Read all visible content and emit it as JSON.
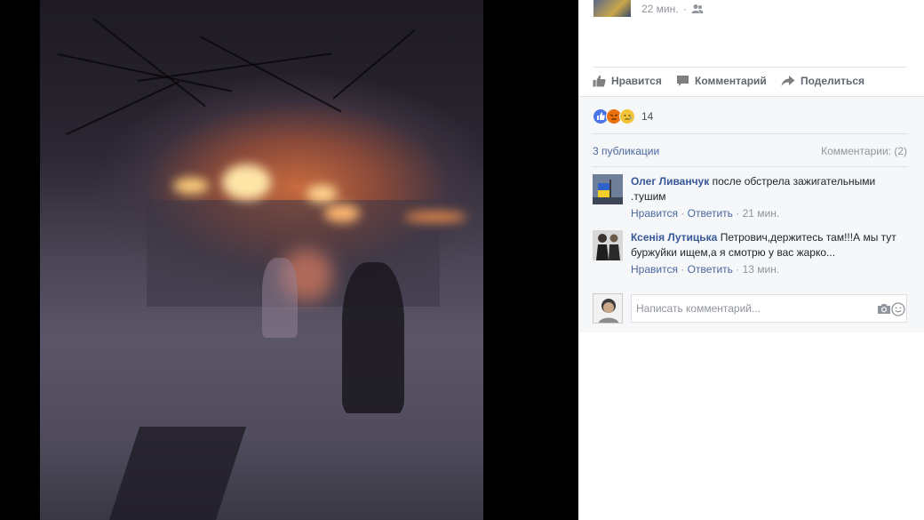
{
  "post": {
    "time": "22 мин.",
    "time_dot": "·",
    "audience_icon": "friends-icon"
  },
  "actions": {
    "like": "Нравится",
    "comment": "Комментарий",
    "share": "Поделиться"
  },
  "reactions": {
    "types": [
      "like",
      "angry",
      "sad"
    ],
    "count": "14"
  },
  "stats": {
    "publications": "3 публикации",
    "comments": "Комментарии: (2)"
  },
  "comments": [
    {
      "author": "Олег Ливанчук",
      "text": "после обстрела зажигательными .тушим",
      "like": "Нравится",
      "reply": "Ответить",
      "time": "21 мин."
    },
    {
      "author": "Ксенія Лутицька",
      "text": "Петрович,держитесь там!!!А мы тут буржуйки ищем,а я смотрю у вас жарко...",
      "like": "Нравится",
      "reply": "Ответить",
      "time": "13 мин."
    }
  ],
  "composer": {
    "placeholder": "Написать комментарий..."
  },
  "colors": {
    "link": "#4b67a1",
    "author": "#365899",
    "muted": "#90949c",
    "panel_bg": "#f6f7f9"
  }
}
